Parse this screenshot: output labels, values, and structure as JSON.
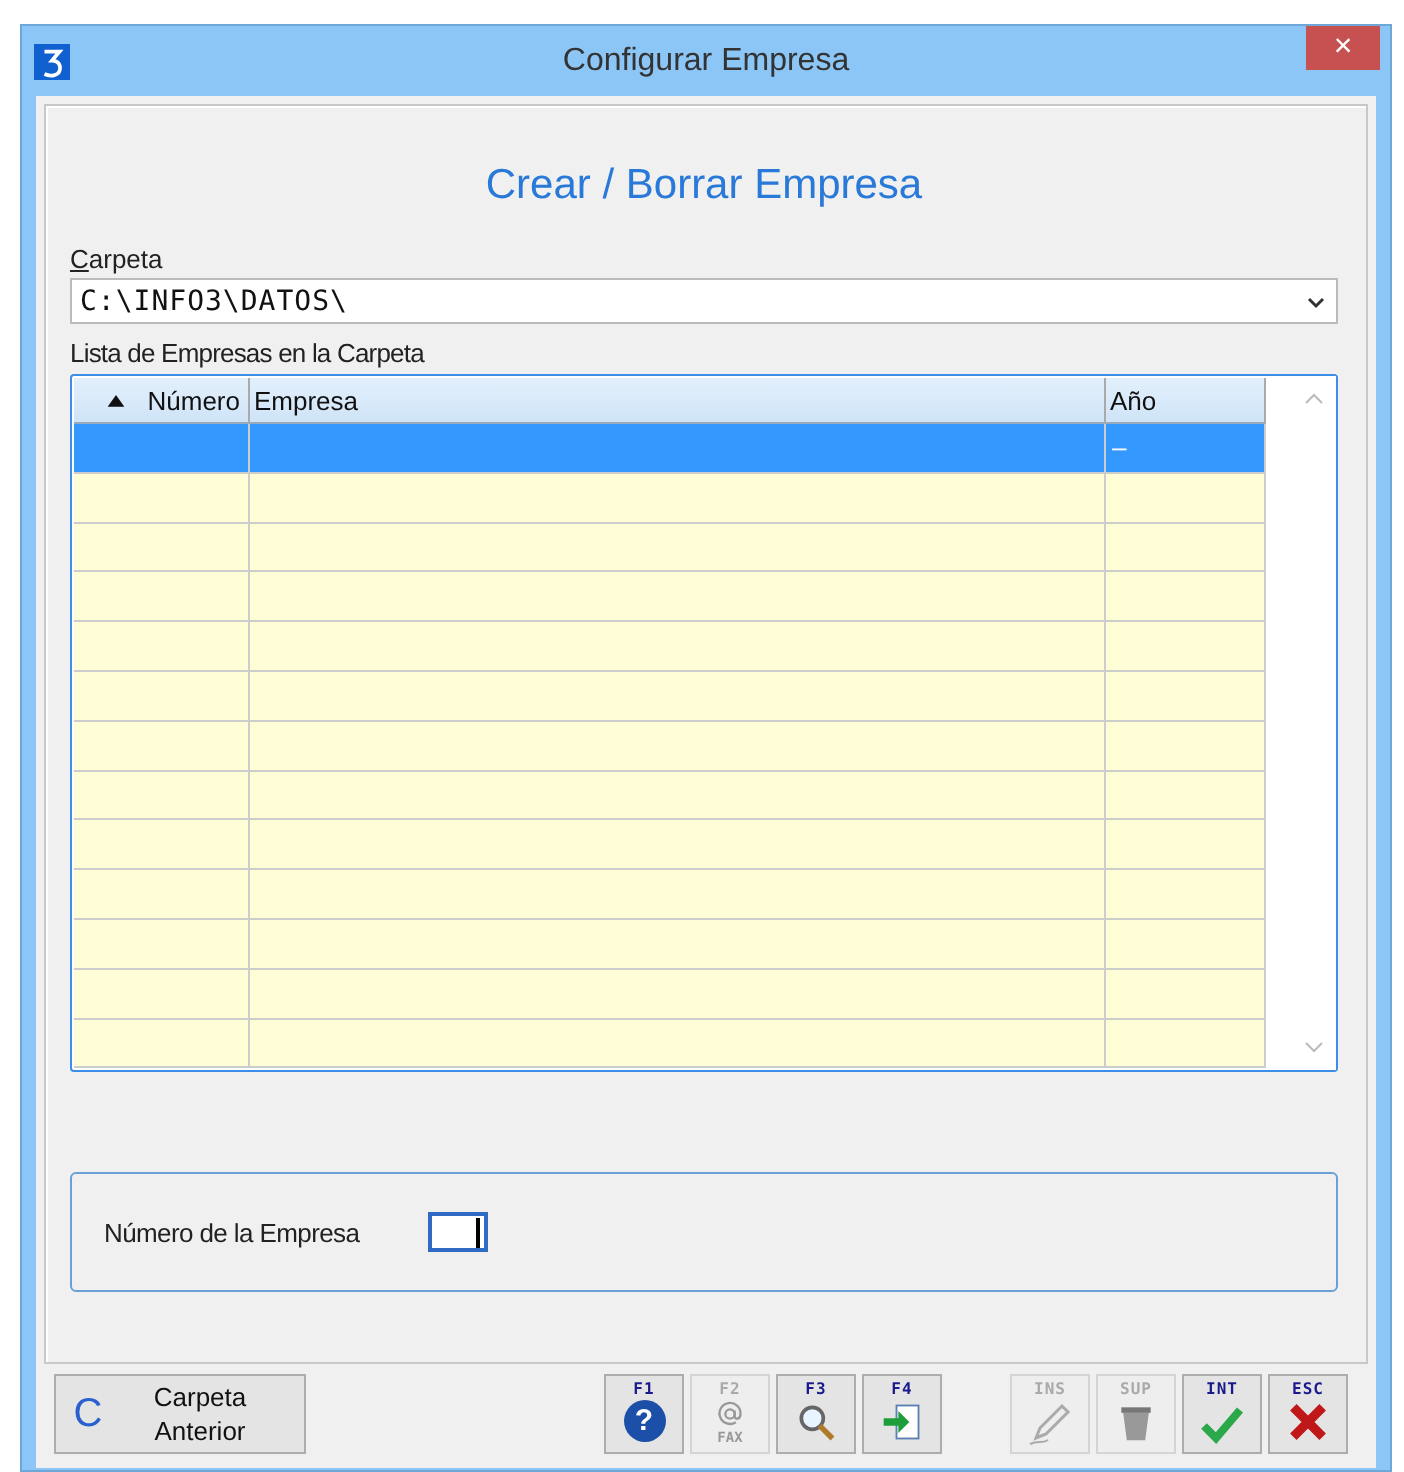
{
  "window": {
    "title": "Configurar Empresa",
    "close": "×"
  },
  "heading": "Crear / Borrar Empresa",
  "folder": {
    "label": "Carpeta",
    "value": "C:\\INFO3\\DATOS\\"
  },
  "list": {
    "label": "Lista de Empresas en la Carpeta",
    "columns": [
      {
        "label": "Número",
        "sorted": true
      },
      {
        "label": "Empresa",
        "sorted": false
      },
      {
        "label": "Año",
        "sorted": false
      }
    ],
    "rows": [
      {
        "selected": true,
        "year": "–"
      },
      {
        "selected": false
      },
      {
        "selected": false
      },
      {
        "selected": false
      },
      {
        "selected": false
      },
      {
        "selected": false
      },
      {
        "selected": false
      },
      {
        "selected": false
      },
      {
        "selected": false
      },
      {
        "selected": false
      },
      {
        "selected": false
      },
      {
        "selected": false
      },
      {
        "selected": false
      }
    ]
  },
  "number_field": {
    "label": "Número de la Empresa"
  },
  "toolbar": {
    "back": {
      "icon": "C",
      "label": "Carpeta Anterior"
    },
    "keys": [
      {
        "key": "F1",
        "kind": "help",
        "disabled": false,
        "glyph": "?"
      },
      {
        "key": "F2",
        "kind": "fax",
        "disabled": true,
        "sub": "FAX"
      },
      {
        "key": "F3",
        "kind": "search",
        "disabled": false
      },
      {
        "key": "F4",
        "kind": "export",
        "disabled": false
      },
      {
        "key": "INS",
        "kind": "edit",
        "disabled": true
      },
      {
        "key": "SUP",
        "kind": "trash",
        "disabled": true
      },
      {
        "key": "INT",
        "kind": "ok",
        "disabled": false
      },
      {
        "key": "ESC",
        "kind": "cancel",
        "disabled": false
      }
    ]
  }
}
